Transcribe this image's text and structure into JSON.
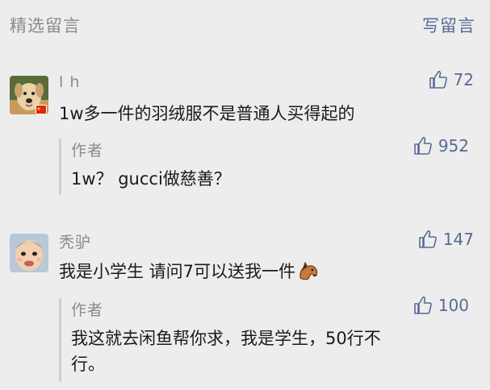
{
  "header": {
    "title": "精选留言",
    "write_label": "写留言"
  },
  "colors": {
    "background": "#ededed",
    "link": "#576b95",
    "muted": "#8a8a8a",
    "text": "#1a1a1a",
    "reply_bar": "#d0d0d0"
  },
  "comments": [
    {
      "nickname": "l h",
      "avatar": "dog-photo-avatar",
      "badge": "china-flag-badge",
      "likes": "72",
      "content": "1w多一件的羽绒服不是普通人买得起的",
      "reply": {
        "author": "作者",
        "likes": "952",
        "content": "1w？ gucci做慈善？"
      }
    },
    {
      "nickname": "秃驴",
      "avatar": "baby-photo-avatar",
      "likes": "147",
      "content": "我是小学生  请问7可以送我一件",
      "emoji": "horse-face-emoji",
      "reply": {
        "author": "作者",
        "likes": "100",
        "content_line1": "我这就去闲鱼帮你求，我是学生，50行不",
        "content_line2": "行。"
      }
    }
  ]
}
